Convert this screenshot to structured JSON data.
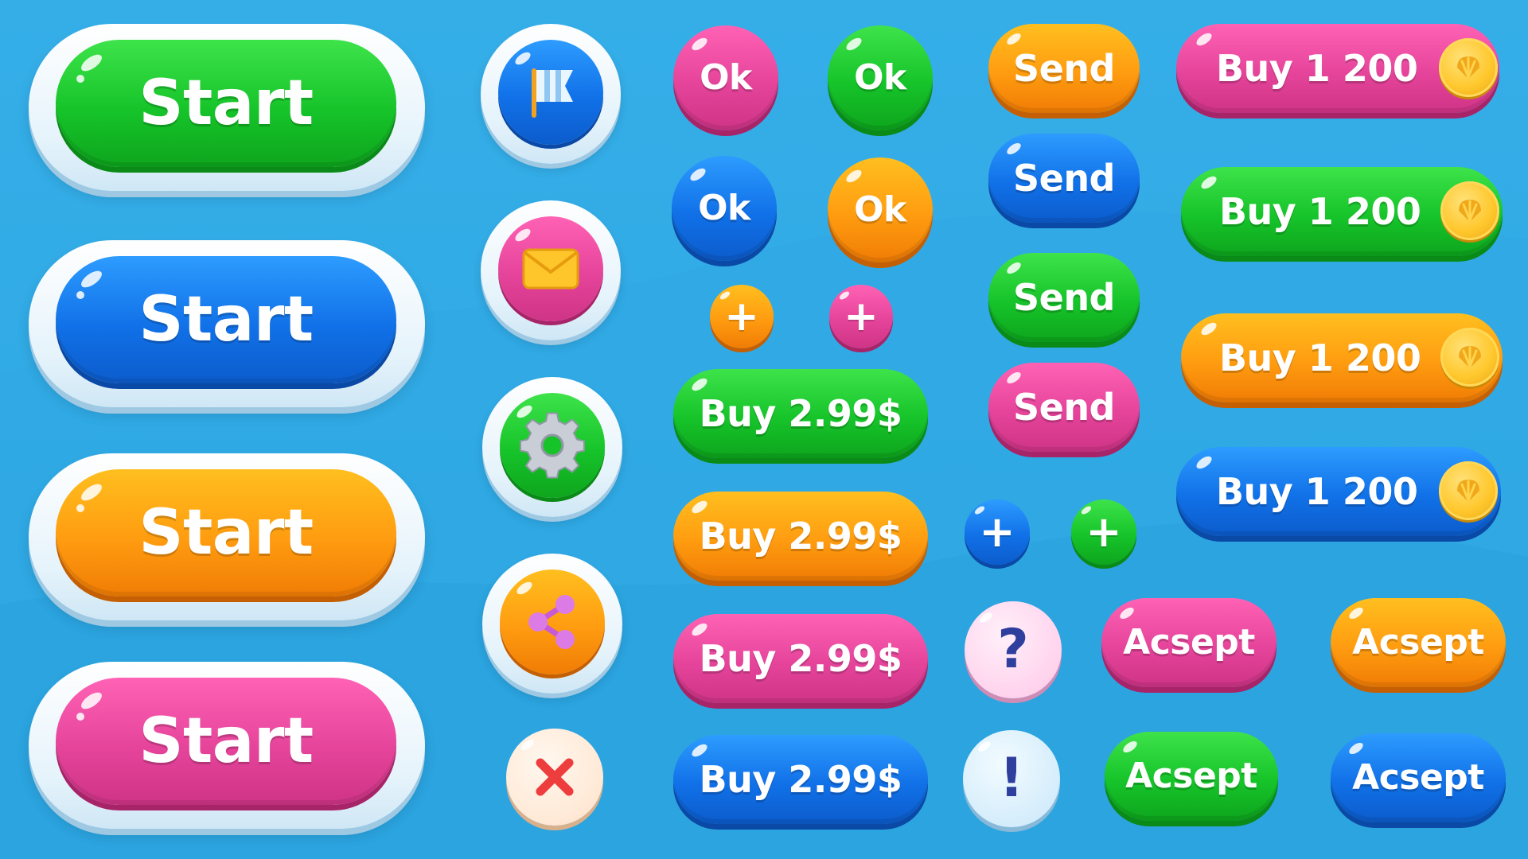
{
  "start_buttons": [
    {
      "label": "Start",
      "color": "green"
    },
    {
      "label": "Start",
      "color": "blue"
    },
    {
      "label": "Start",
      "color": "orange"
    },
    {
      "label": "Start",
      "color": "pink"
    }
  ],
  "icon_buttons": [
    {
      "icon": "flag-icon",
      "color": "#1a7ff0"
    },
    {
      "icon": "envelope-icon",
      "color": "#e5449a"
    },
    {
      "icon": "gear-icon",
      "color": "#16c42a"
    },
    {
      "icon": "share-icon",
      "color": "#ff9c10"
    },
    {
      "icon": "close-icon",
      "color": "#ffe9d6"
    }
  ],
  "ok_buttons": [
    {
      "label": "Ok",
      "color": "pink"
    },
    {
      "label": "Ok",
      "color": "green"
    },
    {
      "label": "Ok",
      "color": "blue"
    },
    {
      "label": "Ok",
      "color": "orange"
    }
  ],
  "plus_glyph": "+",
  "buy_price_buttons": [
    {
      "label": "Buy 2.99$",
      "color": "green"
    },
    {
      "label": "Buy 2.99$",
      "color": "orange"
    },
    {
      "label": "Buy 2.99$",
      "color": "pink"
    },
    {
      "label": "Buy 2.99$",
      "color": "blue"
    }
  ],
  "send_buttons": [
    {
      "label": "Send",
      "color": "orange"
    },
    {
      "label": "Send",
      "color": "blue"
    },
    {
      "label": "Send",
      "color": "green"
    },
    {
      "label": "Send",
      "color": "pink"
    }
  ],
  "buy_coin_buttons": [
    {
      "label": "Buy 1 200",
      "color": "pink"
    },
    {
      "label": "Buy 1 200",
      "color": "green"
    },
    {
      "label": "Buy 1 200",
      "color": "orange"
    },
    {
      "label": "Buy 1 200",
      "color": "blue"
    }
  ],
  "help": {
    "question": "?",
    "exclamation": "!"
  },
  "accept_buttons": [
    {
      "label": "Acsept",
      "color": "pink"
    },
    {
      "label": "Acsept",
      "color": "orange"
    },
    {
      "label": "Acsept",
      "color": "green"
    },
    {
      "label": "Acsept",
      "color": "blue"
    }
  ],
  "colors": {
    "background": "#2ca6e2",
    "green": "#16c42a",
    "blue": "#1171e8",
    "orange": "#ff9c10",
    "pink": "#e5449a",
    "coin": "#ffc82e"
  }
}
